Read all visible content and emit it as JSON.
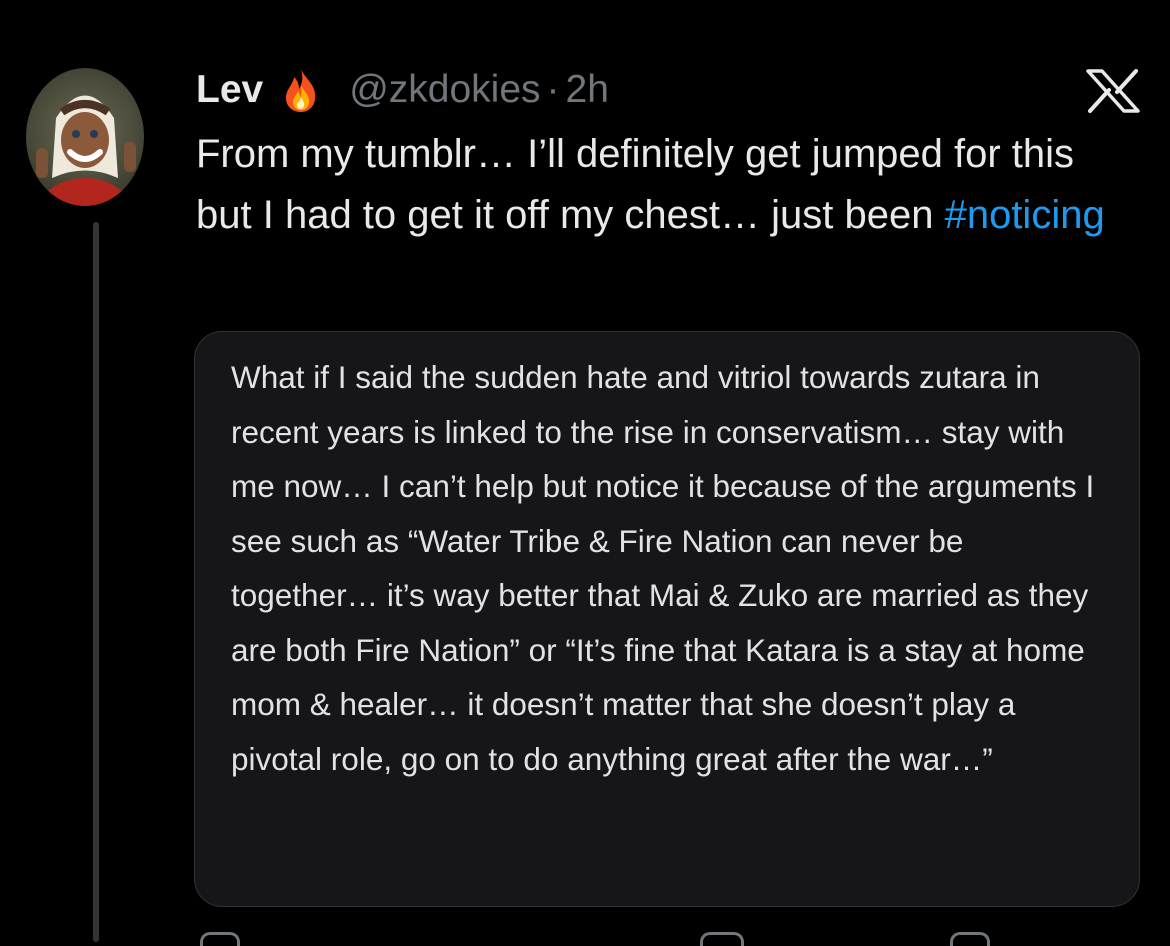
{
  "tweet": {
    "author_name": "Lev",
    "name_emoji": "fire-icon",
    "handle": "@zkdokies",
    "separator": "·",
    "timestamp": "2h",
    "text_main": "From my tumblr… I’ll definitely get jumped for this but I had to get it off my chest… just been ",
    "hashtag": "#noticing",
    "hashtag_color": "#1d9bf0"
  },
  "attached_image": {
    "text": "What if I said the sudden hate and vitriol towards zutara in recent years is linked to the rise in conservatism… stay with me now… I can’t help but notice it because of the arguments I see such as “Water Tribe & Fire Nation can never be together… it’s way better that Mai & Zuko are married as they are both Fire Nation” or “It’s fine that Katara is a stay at home mom & healer… it doesn’t matter that she doesn’t play a pivotal role, go on to do anything great after the war…”"
  },
  "colors": {
    "background": "#000000",
    "text_primary": "#e7e9ea",
    "text_secondary": "#71767b",
    "card_background": "#161618"
  },
  "icons": {
    "close": "x-logo-icon"
  }
}
